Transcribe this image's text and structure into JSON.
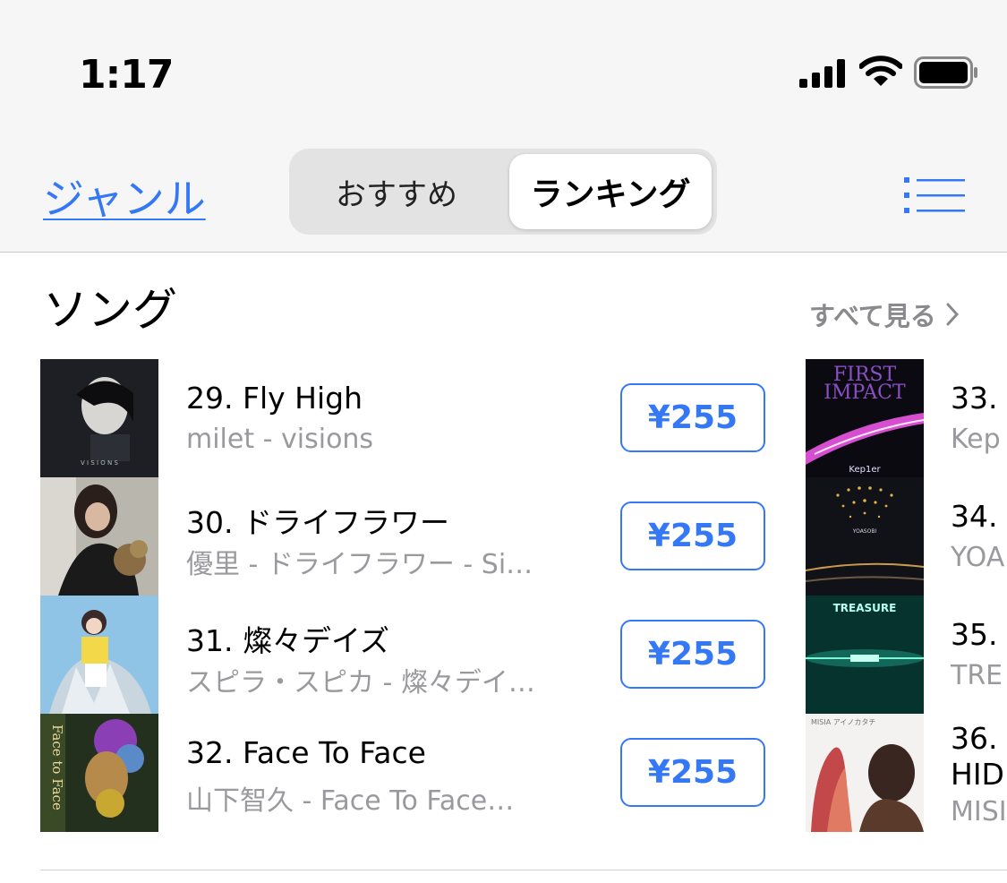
{
  "status_bar": {
    "time": "1:17"
  },
  "nav": {
    "genre_label": "ジャンル",
    "segments": [
      "おすすめ",
      "ランキング"
    ],
    "selected_segment": "ランキング"
  },
  "section": {
    "title": "ソング",
    "see_all": "すべて見る"
  },
  "songs": [
    {
      "title": "29. Fly High",
      "subtitle": "milet - visions",
      "price": "¥255"
    },
    {
      "title": "30. ドライフラワー",
      "subtitle": "優里 - ドライフラワー - Si…",
      "price": "¥255"
    },
    {
      "title": "31. 燦々デイズ",
      "subtitle": "スピラ・スピカ - 燦々デイ…",
      "price": "¥255"
    },
    {
      "title": "32. Face To Face",
      "subtitle": "山下智久 - Face To Face…",
      "price": "¥255"
    }
  ],
  "songs_right": [
    {
      "title": "33.",
      "subtitle": "Kep"
    },
    {
      "title": "34.",
      "subtitle": "YOA"
    },
    {
      "title": "35.",
      "subtitle": "TRE"
    },
    {
      "title": "36.",
      "title_line2": "HID",
      "subtitle": "MISI"
    }
  ],
  "artwork_text": {
    "a29": "V I S I O N S",
    "a32": "Face to Face",
    "a33_line1": "FIRST",
    "a33_line2": "IMPACT",
    "a33_brand": "Kep1er",
    "a34": "YOASOBI",
    "a35": "TREASURE",
    "a36": "MISIA アイノカタチ"
  },
  "colors": {
    "accent": "#3478f6",
    "secondary_text": "#9a9a9e"
  }
}
